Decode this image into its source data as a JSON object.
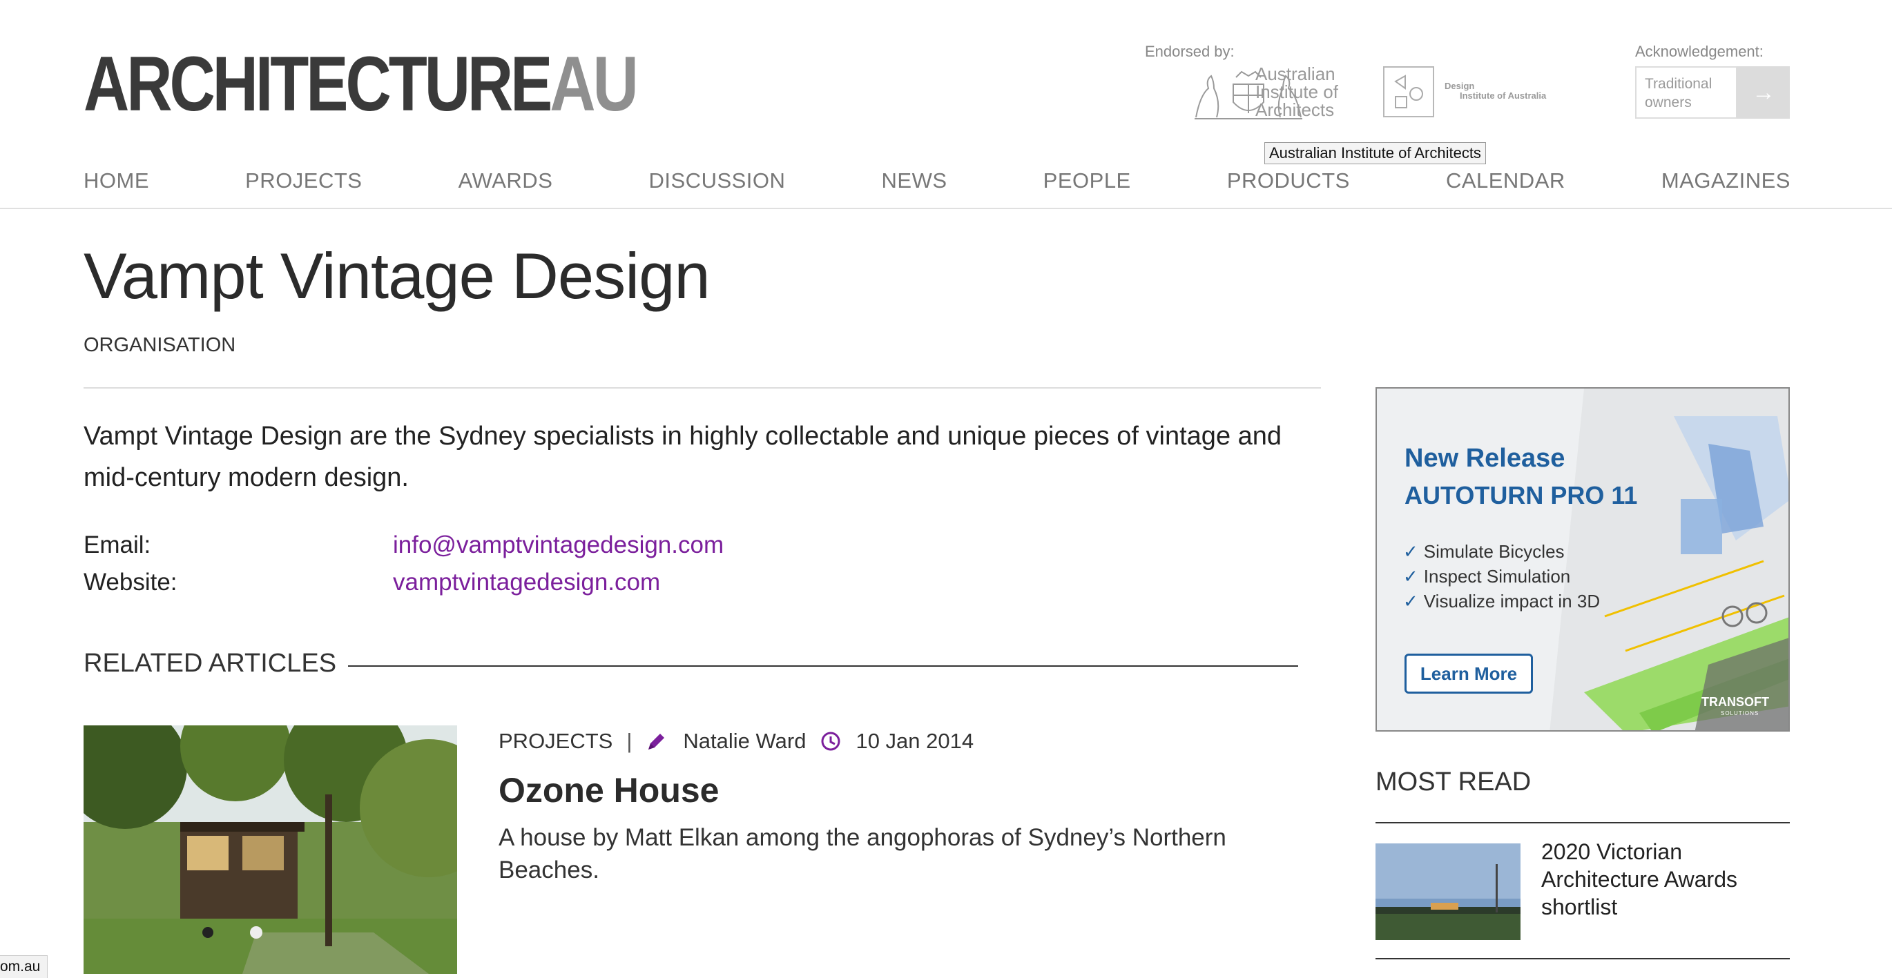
{
  "logo": {
    "part1": "ARCHITECTURE",
    "part2": "AU"
  },
  "header": {
    "endorsed_label": "Endorsed by:",
    "aia_name_lines": [
      "Australian",
      "Institute of",
      "Architects"
    ],
    "dia_name": [
      "Design",
      "Institute of Australia"
    ],
    "ack_label": "Acknowledgement:",
    "trad_owners": "Traditional owners",
    "tooltip": "Australian Institute of Architects"
  },
  "nav": [
    "HOME",
    "PROJECTS",
    "AWARDS",
    "DISCUSSION",
    "NEWS",
    "PEOPLE",
    "PRODUCTS",
    "CALENDAR",
    "MAGAZINES"
  ],
  "page": {
    "title": "Vampt Vintage Design",
    "type": "ORGANISATION",
    "description": "Vampt Vintage Design are the Sydney specialists in highly collectable and unique pieces of vintage and mid-century modern design.",
    "email_label": "Email:",
    "email": "info@vamptvintagedesign.com",
    "website_label": "Website:",
    "website": "vamptvintagedesign.com"
  },
  "related": {
    "heading": "RELATED ARTICLES",
    "article": {
      "category": "PROJECTS",
      "separator": "|",
      "author": "Natalie Ward",
      "date": "10 Jan 2014",
      "title": "Ozone House",
      "summary": "A house by Matt Elkan among the angophoras of Sydney’s Northern Beaches."
    }
  },
  "ad": {
    "line1": "New Release",
    "line2": "AUTOTURN PRO 11",
    "bullets": [
      "Simulate Bicycles",
      "Inspect Simulation",
      "Visualize impact in 3D"
    ],
    "cta": "Learn More",
    "brand": "TRANSOFT",
    "brand_sub": "SOLUTIONS"
  },
  "most_read": {
    "heading": "MOST READ",
    "items": [
      {
        "title": "2020 Victorian Architecture Awards shortlist"
      }
    ]
  },
  "status_bar": "om.au",
  "colors": {
    "link": "#7b1f9c",
    "ad_blue": "#1f5f9e"
  }
}
